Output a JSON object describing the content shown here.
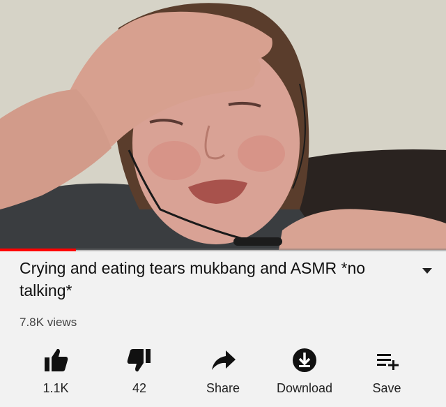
{
  "player": {
    "progress_fraction": 0.17,
    "progress_color": "#ff0000"
  },
  "video": {
    "title": "Crying and eating tears mukbang and ASMR *no talking*",
    "views": "7.8K views"
  },
  "actions": [
    {
      "icon": "thumbs-up-icon",
      "label": "1.1K"
    },
    {
      "icon": "thumbs-down-icon",
      "label": "42"
    },
    {
      "icon": "share-icon",
      "label": "Share"
    },
    {
      "icon": "download-icon",
      "label": "Download"
    },
    {
      "icon": "save-playlist-icon",
      "label": "Save"
    }
  ]
}
